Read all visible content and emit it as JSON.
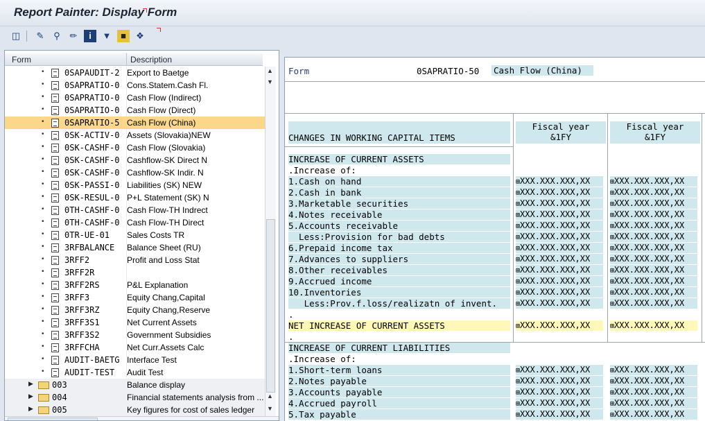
{
  "window": {
    "title": "Report Painter: Display Form"
  },
  "toolbar": {
    "icons": [
      "hierarchy-icon",
      "edit-icon",
      "search-icon",
      "change-icon",
      "info-icon",
      "filter-icon",
      "transport-icon",
      "network-icon"
    ]
  },
  "tree": {
    "columns": [
      "Form",
      "Description"
    ],
    "rows": [
      {
        "type": "item",
        "name": "0SAPAUDIT-2",
        "desc": "Export to Baetge"
      },
      {
        "type": "item",
        "name": "0SAPRATIO-0",
        "desc": "Cons.Statem.Cash Fl."
      },
      {
        "type": "item",
        "name": "0SAPRATIO-0",
        "desc": "Cash Flow (Indirect)"
      },
      {
        "type": "item",
        "name": "0SAPRATIO-0",
        "desc": "Cash Flow (Direct)"
      },
      {
        "type": "item",
        "name": "0SAPRATIO-5",
        "desc": "Cash Flow  (China)",
        "selected": true
      },
      {
        "type": "item",
        "name": "0SK-ACTIV-0",
        "desc": "Assets (Slovakia)NEW"
      },
      {
        "type": "item",
        "name": "0SK-CASHF-0",
        "desc": "Cash Flow (Slovakia)"
      },
      {
        "type": "item",
        "name": "0SK-CASHF-0",
        "desc": "Cashflow-SK Direct N"
      },
      {
        "type": "item",
        "name": "0SK-CASHF-0",
        "desc": "Cashflow-SK Indir. N"
      },
      {
        "type": "item",
        "name": "0SK-PASSI-0",
        "desc": "Liabilities (SK) NEW"
      },
      {
        "type": "item",
        "name": "0SK-RESUL-0",
        "desc": "P+L Statement (SK) N"
      },
      {
        "type": "item",
        "name": "0TH-CASHF-0",
        "desc": "Cash Flow-TH Indrect"
      },
      {
        "type": "item",
        "name": "0TH-CASHF-0",
        "desc": "Cash Flow-TH Direct"
      },
      {
        "type": "item",
        "name": "0TR-UE-01",
        "desc": "Sales Costs TR"
      },
      {
        "type": "item",
        "name": "3RFBALANCE",
        "desc": "Balance Sheet (RU)"
      },
      {
        "type": "item",
        "name": "3RFF2",
        "desc": "Profit and Loss Stat"
      },
      {
        "type": "item",
        "name": "3RFF2R",
        "desc": ""
      },
      {
        "type": "item",
        "name": "3RFF2RS",
        "desc": "P&L Explanation"
      },
      {
        "type": "item",
        "name": "3RFF3",
        "desc": "Equity Chang,Capital"
      },
      {
        "type": "item",
        "name": "3RFF3RZ",
        "desc": "Equity Chang,Reserve"
      },
      {
        "type": "item",
        "name": "3RFF3S1",
        "desc": "Net Current Assets"
      },
      {
        "type": "item",
        "name": "3RFF3S2",
        "desc": "Government Subsidies"
      },
      {
        "type": "item",
        "name": "3RFFCHA",
        "desc": "Net Curr.Assets Calc"
      },
      {
        "type": "item",
        "name": "AUDIT-BAETG",
        "desc": "Interface Test"
      },
      {
        "type": "item",
        "name": "AUDIT-TEST",
        "desc": "Audit Test"
      },
      {
        "type": "folder",
        "name": "003",
        "desc": "Balance display"
      },
      {
        "type": "folder",
        "name": "004",
        "desc": "Financial statements analysis from ..."
      },
      {
        "type": "folder",
        "name": "005",
        "desc": "Key figures for cost of sales ledger"
      }
    ]
  },
  "form": {
    "label": "Form",
    "id": "0SAPRATIO-50",
    "title": "Cash Flow  (China)",
    "main_header": "CHANGES IN WORKING CAPITAL ITEMS",
    "columns": [
      {
        "line1": "Fiscal year",
        "line2": "&1FY"
      },
      {
        "line1": "Fiscal year",
        "line2": "&1FY"
      }
    ],
    "value_mask": "XXX.XXX.XXX,XX",
    "lines": [
      {
        "text": "INCREASE OF CURRENT ASSETS",
        "kind": "hdr"
      },
      {
        "text": ".Increase of:",
        "kind": "plain"
      },
      {
        "text": "1.Cash on hand",
        "kind": "row"
      },
      {
        "text": "2.Cash in bank",
        "kind": "row"
      },
      {
        "text": "3.Marketable securities",
        "kind": "row"
      },
      {
        "text": "4.Notes receivable",
        "kind": "row"
      },
      {
        "text": "5.Accounts receivable",
        "kind": "row"
      },
      {
        "text": "  Less:Provision for bad debts",
        "kind": "row"
      },
      {
        "text": "6.Prepaid income tax",
        "kind": "row"
      },
      {
        "text": "7.Advances to suppliers",
        "kind": "row"
      },
      {
        "text": "8.Other receivables",
        "kind": "row"
      },
      {
        "text": "9.Accrued income",
        "kind": "row"
      },
      {
        "text": "10.Inventories",
        "kind": "row"
      },
      {
        "text": "   Less:Prov.f.loss/realizatn of invent.",
        "kind": "row"
      },
      {
        "text": ".",
        "kind": "plain"
      },
      {
        "text": "NET INCREASE OF CURRENT ASSETS",
        "kind": "total"
      },
      {
        "text": ".",
        "kind": "plain"
      },
      {
        "text": "INCREASE OF CURRENT LIABILITIES",
        "kind": "hdr"
      },
      {
        "text": ".Increase of:",
        "kind": "plain"
      },
      {
        "text": "1.Short-term loans",
        "kind": "row"
      },
      {
        "text": "2.Notes payable",
        "kind": "row"
      },
      {
        "text": "3.Accounts payable",
        "kind": "row"
      },
      {
        "text": "4.Accrued payroll",
        "kind": "row"
      },
      {
        "text": "5.Tax payable",
        "kind": "row"
      }
    ]
  }
}
